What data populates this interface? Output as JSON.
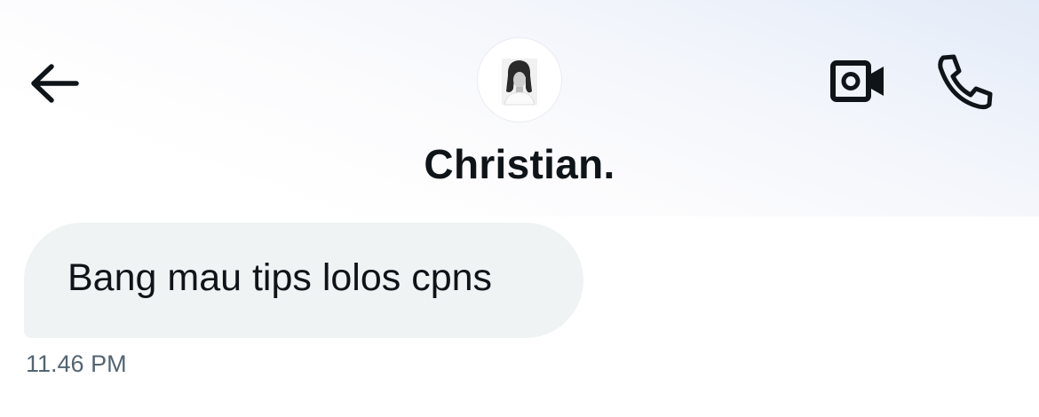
{
  "header": {
    "contact_name": "Christian.",
    "back_icon": "arrow-left-icon",
    "video_icon": "video-camera-icon",
    "call_icon": "phone-icon"
  },
  "avatar": {
    "description": "black and white portrait"
  },
  "messages": [
    {
      "text": "Bang mau tips lolos cpns",
      "time": "11.46 PM",
      "direction": "incoming"
    }
  ],
  "colors": {
    "text_primary": "#0f1419",
    "text_secondary": "#536471",
    "bubble_bg": "#eff3f4"
  }
}
